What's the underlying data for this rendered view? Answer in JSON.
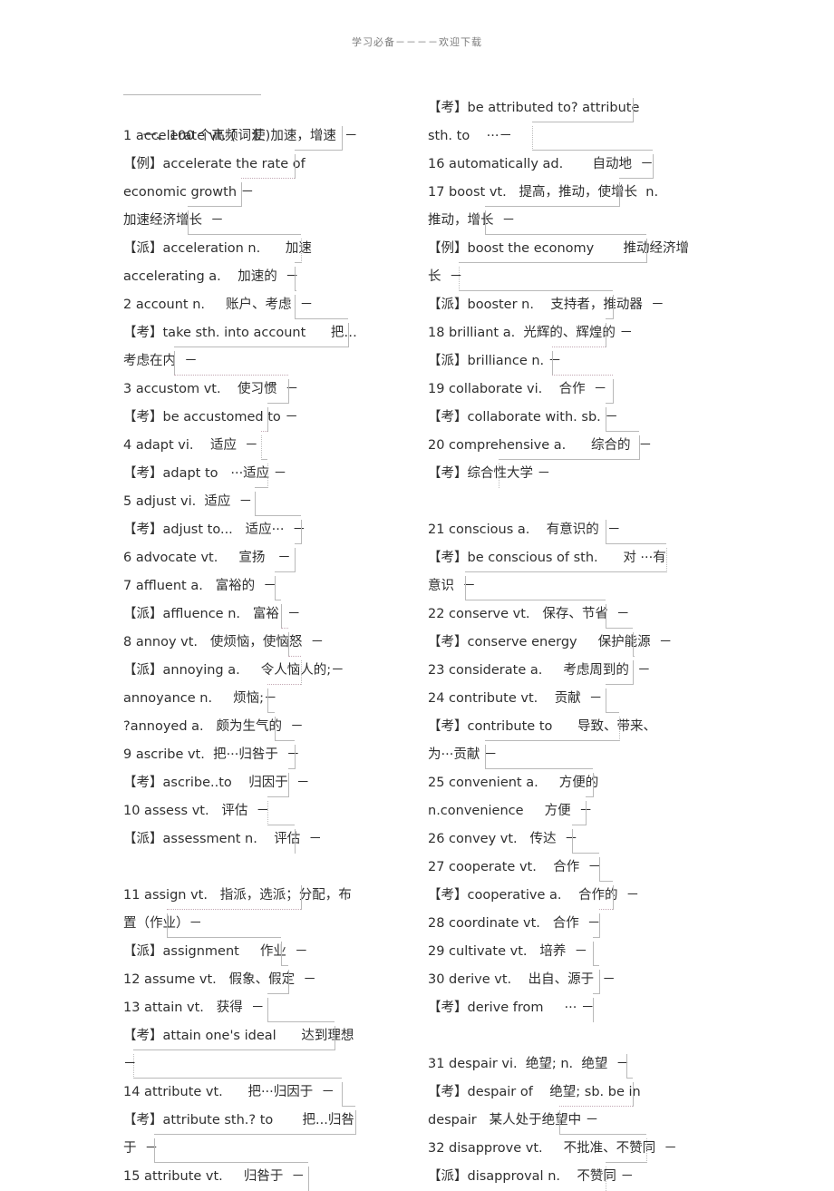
{
  "document": {
    "header_watermark": "学习必备－－－－欢迎下载",
    "heading": "一、100 个高频词汇"
  },
  "left_column": {
    "lines": [
      {
        "text": "1 accelerate vt. (    使)加速，增速  －"
      },
      {
        "text": "【例】accelerate the rate of"
      },
      {
        "text": "economic growth －"
      },
      {
        "text": "加速经济增长  －"
      },
      {
        "text": "【派】acceleration n.      加速"
      },
      {
        "text": "accelerating a.    加速的  －"
      },
      {
        "text": "2 account n.     账户、考虑  －"
      },
      {
        "text": "【考】take sth. into account      把…"
      },
      {
        "text": "考虑在内  －"
      },
      {
        "text": "3 accustom vt.    使习惯  －"
      },
      {
        "text": "【考】be accustomed to －"
      },
      {
        "text": "4 adapt vi.    适应  －"
      },
      {
        "text": "【考】adapt to   ···适应 －"
      },
      {
        "text": "5 adjust vi.  适应  －"
      },
      {
        "text": "【考】adjust to...   适应···  －"
      },
      {
        "text": "6 advocate vt.     宣扬   －"
      },
      {
        "text": "7 affluent a.   富裕的  －"
      },
      {
        "text": "【派】affluence n.   富裕  －"
      },
      {
        "text": "8 annoy vt.   使烦恼，使恼怒  －"
      },
      {
        "text": "【派】annoying a.     令人恼人的;－"
      },
      {
        "text": "annoyance n.     烦恼;－"
      },
      {
        "text": "?annoyed a.   颇为生气的  －"
      },
      {
        "text": "9 ascribe vt.  把···归咎于  －"
      },
      {
        "text": "【考】ascribe..to    归因于  －"
      },
      {
        "text": "10 assess vt.   评估  －"
      },
      {
        "text": "【派】assessment n.    评估  －"
      },
      {
        "text": "",
        "blank": true
      },
      {
        "text": "11 assign vt.   指派，选派；分配，布"
      },
      {
        "text": "置（作业）－"
      },
      {
        "text": "【派】assignment     作业  －"
      },
      {
        "text": "12 assume vt.   假象、假定  －"
      },
      {
        "text": "13 attain vt.   获得  －"
      },
      {
        "text": "【考】attain one's ideal      达到理想"
      },
      {
        "text": "－"
      },
      {
        "text": "14 attribute vt.      把···归因于  －"
      },
      {
        "text": "【考】attribute sth.? to       把...归咎"
      },
      {
        "text": "于  －"
      },
      {
        "text": "15 attribute vt.     归咎于  －"
      }
    ]
  },
  "right_column": {
    "lines": [
      {
        "text": "【考】be attributed to? attribute"
      },
      {
        "text": "sth. to    ···－"
      },
      {
        "text": "16 automatically ad.       自动地  －"
      },
      {
        "text": "17 boost vt.   提高，推动，使增长  n."
      },
      {
        "text": "推动，增长  －"
      },
      {
        "text": "【例】boost the economy       推动经济增"
      },
      {
        "text": "长  －"
      },
      {
        "text": "【派】booster n.    支持者，推动器  －"
      },
      {
        "text": "18 brilliant a.  光辉的、辉煌的 －"
      },
      {
        "text": "【派】brilliance n. －"
      },
      {
        "text": "19 collaborate vi.    合作  －"
      },
      {
        "text": "【考】collaborate with. sb. －"
      },
      {
        "text": "20 comprehensive a.      综合的  －"
      },
      {
        "text": "【考】综合性大学 －"
      },
      {
        "text": "",
        "blank": true
      },
      {
        "text": "21 conscious a.    有意识的  －"
      },
      {
        "text": "【考】be conscious of sth.      对 ···有"
      },
      {
        "text": "意识  －"
      },
      {
        "text": "22 conserve vt.   保存、节省  －"
      },
      {
        "text": "【考】conserve energy     保护能源  －"
      },
      {
        "text": "23 considerate a.     考虑周到的  －"
      },
      {
        "text": "24 contribute vt.    贡献  －"
      },
      {
        "text": "【考】contribute to      导致、带来、"
      },
      {
        "text": "为···贡献 －"
      },
      {
        "text": "25 convenient a.     方便的"
      },
      {
        "text": "n.convenience     方便  －"
      },
      {
        "text": "26 convey vt.   传达  －"
      },
      {
        "text": "27 cooperate vt.    合作  －"
      },
      {
        "text": "【考】cooperative a.    合作的  －"
      },
      {
        "text": "28 coordinate vt.   合作  －"
      },
      {
        "text": "29 cultivate vt.   培养  －"
      },
      {
        "text": "30 derive vt.    出自、源于  －"
      },
      {
        "text": "【考】derive from     ··· －"
      },
      {
        "text": "",
        "blank": true
      },
      {
        "text": "31 despair vi.  绝望; n.  绝望  －"
      },
      {
        "text": "【考】despair of    绝望; sb. be in"
      },
      {
        "text": "despair   某人处于绝望中 －"
      },
      {
        "text": "32 disapprove vt.     不批准、不赞同  －"
      },
      {
        "text": "【派】disapproval n.    不赞同 －"
      }
    ]
  },
  "colors": {
    "text": "#2f2f2f",
    "rule": "#b9b9b9",
    "dotted_rule": "#c3a8b4",
    "background": "#ffffff"
  }
}
